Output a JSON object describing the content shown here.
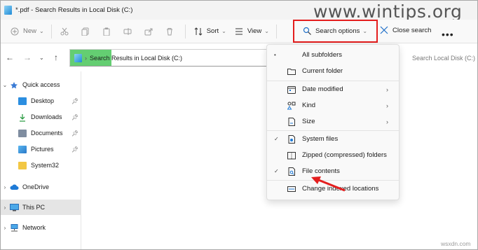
{
  "window": {
    "title": "*.pdf - Search Results in Local Disk (C:)"
  },
  "watermark": "www.wintips.org",
  "toolbar": {
    "new_label": "New",
    "sort_label": "Sort",
    "view_label": "View",
    "search_options_label": "Search options",
    "close_search_label": "Close search",
    "more_label": "•••"
  },
  "address": {
    "path": "Search Results in Local Disk (C:)",
    "search_placeholder": "Search Local Disk (C:)",
    "progress_fraction": 0.21
  },
  "sidebar": {
    "items": [
      {
        "label": "Quick access",
        "icon": "star-icon"
      },
      {
        "label": "Desktop",
        "icon": "desktop-folder-icon"
      },
      {
        "label": "Downloads",
        "icon": "download-icon"
      },
      {
        "label": "Documents",
        "icon": "documents-icon"
      },
      {
        "label": "Pictures",
        "icon": "pictures-icon"
      },
      {
        "label": "System32",
        "icon": "folder-icon"
      },
      {
        "label": "OneDrive",
        "icon": "cloud-icon"
      },
      {
        "label": "This PC",
        "icon": "pc-icon"
      },
      {
        "label": "Network",
        "icon": "network-icon"
      }
    ]
  },
  "menu": {
    "items": [
      {
        "label": "All subfolders",
        "mark": "•",
        "icon": ""
      },
      {
        "label": "Current folder",
        "mark": "",
        "icon": "folder-outline-icon"
      },
      {
        "label": "Date modified",
        "mark": "",
        "icon": "calendar-icon",
        "submenu": true
      },
      {
        "label": "Kind",
        "mark": "",
        "icon": "kind-icon",
        "submenu": true
      },
      {
        "label": "Size",
        "mark": "",
        "icon": "size-icon",
        "submenu": true
      },
      {
        "label": "System files",
        "mark": "✓",
        "icon": "system-file-icon"
      },
      {
        "label": "Zipped (compressed) folders",
        "mark": "",
        "icon": "zip-icon"
      },
      {
        "label": "File contents",
        "mark": "✓",
        "icon": "file-contents-icon"
      },
      {
        "label": "Change indexed locations",
        "mark": "",
        "icon": "index-icon"
      }
    ]
  },
  "colors": {
    "highlight_box": "#e41e1e",
    "progress": "#64ce72",
    "accent": "#1e8ad6"
  },
  "corner_mark": "wsxdn.com"
}
